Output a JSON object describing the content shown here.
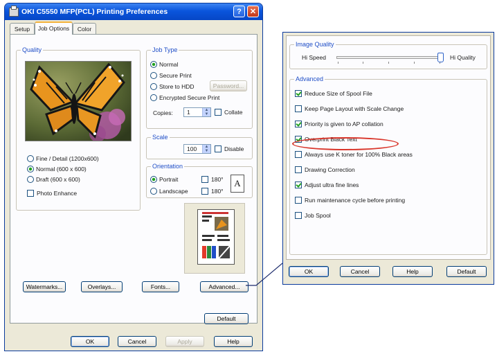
{
  "window": {
    "title": "OKI C5550 MFP(PCL) Printing Preferences",
    "help_glyph": "?",
    "close_glyph": "✕"
  },
  "tabs": [
    "Setup",
    "Job Options",
    "Color"
  ],
  "quality": {
    "legend": "Quality",
    "options": [
      "Fine / Detail (1200x600)",
      "Normal (600 x 600)",
      "Draft (600 x 600)"
    ],
    "selected": "Normal (600 x 600)",
    "photo_enhance": "Photo Enhance"
  },
  "job_type": {
    "legend": "Job Type",
    "options": [
      "Normal",
      "Secure Print",
      "Store to HDD",
      "Encrypted Secure Print"
    ],
    "selected": "Normal",
    "password_button": "Password...",
    "copies_label": "Copies:",
    "copies_value": "1",
    "collate": "Collate"
  },
  "scale": {
    "legend": "Scale",
    "value": "100",
    "disable": "Disable"
  },
  "orientation": {
    "legend": "Orientation",
    "portrait": "Portrait",
    "landscape": "Landscape",
    "rotate": "180°",
    "preview_letter": "A"
  },
  "buttons": {
    "watermarks": "Watermarks...",
    "overlays": "Overlays...",
    "fonts": "Fonts...",
    "advanced": "Advanced...",
    "default": "Default",
    "ok": "OK",
    "cancel": "Cancel",
    "apply": "Apply",
    "help": "Help"
  },
  "advanced_dialog": {
    "image_quality": {
      "legend": "Image Quality",
      "low": "Hi Speed",
      "high": "Hi Quality",
      "level": 1.0
    },
    "advanced_legend": "Advanced",
    "options": [
      {
        "label": "Reduce Size of Spool File",
        "checked": true
      },
      {
        "label": "Keep Page Layout with Scale Change",
        "checked": false
      },
      {
        "label": "Priority is given to AP collation",
        "checked": true
      },
      {
        "label": "Overprint Black Text",
        "checked": true
      },
      {
        "label": "Always use K toner for 100% Black areas",
        "checked": false
      },
      {
        "label": "Drawing Correction",
        "checked": false
      },
      {
        "label": "Adjust ultra fine lines",
        "checked": true
      },
      {
        "label": "Run maintenance cycle before printing",
        "checked": false
      },
      {
        "label": "Job Spool",
        "checked": false
      }
    ],
    "buttons": {
      "ok": "OK",
      "cancel": "Cancel",
      "help": "Help",
      "default": "Default"
    }
  },
  "colors": {
    "title_bar": "#0a55dc",
    "legend_blue": "#1f4ec7",
    "check_green": "#21a121",
    "highlight_red": "#d9362b"
  }
}
